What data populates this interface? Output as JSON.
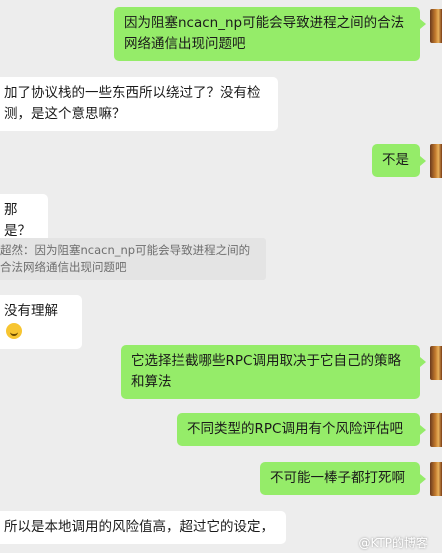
{
  "messages": [
    {
      "side": "out",
      "text": "因为阻塞ncacn_np可能会导致进程之间的合法网络通信出现问题吧"
    },
    {
      "side": "in",
      "text": "加了协议栈的一些东西所以绕过了？没有检测，是这个意思嘛？"
    },
    {
      "side": "out",
      "text": "不是"
    },
    {
      "side": "in",
      "text": "那是？"
    },
    {
      "side": "quote",
      "text": "超然：因为阻塞ncacn_np可能会导致进程之间的合法网络通信出现问题吧"
    },
    {
      "side": "in",
      "text": "没有理解"
    },
    {
      "side": "out",
      "text": "它选择拦截哪些RPC调用取决于它自己的策略和算法"
    },
    {
      "side": "out",
      "text": "不同类型的RPC调用有个风险评估吧"
    },
    {
      "side": "out",
      "text": "不可能一棒子都打死啊"
    },
    {
      "side": "in",
      "text": "所以是本地调用的风险值高，超过它的设定，"
    }
  ],
  "watermark": "@KTP的博客",
  "colors": {
    "outgoing": "#95ec69",
    "incoming": "#ffffff",
    "background": "#ededed"
  },
  "icons": {
    "emoji": "embarrassed-smile-icon",
    "avatar": "user-avatar"
  }
}
